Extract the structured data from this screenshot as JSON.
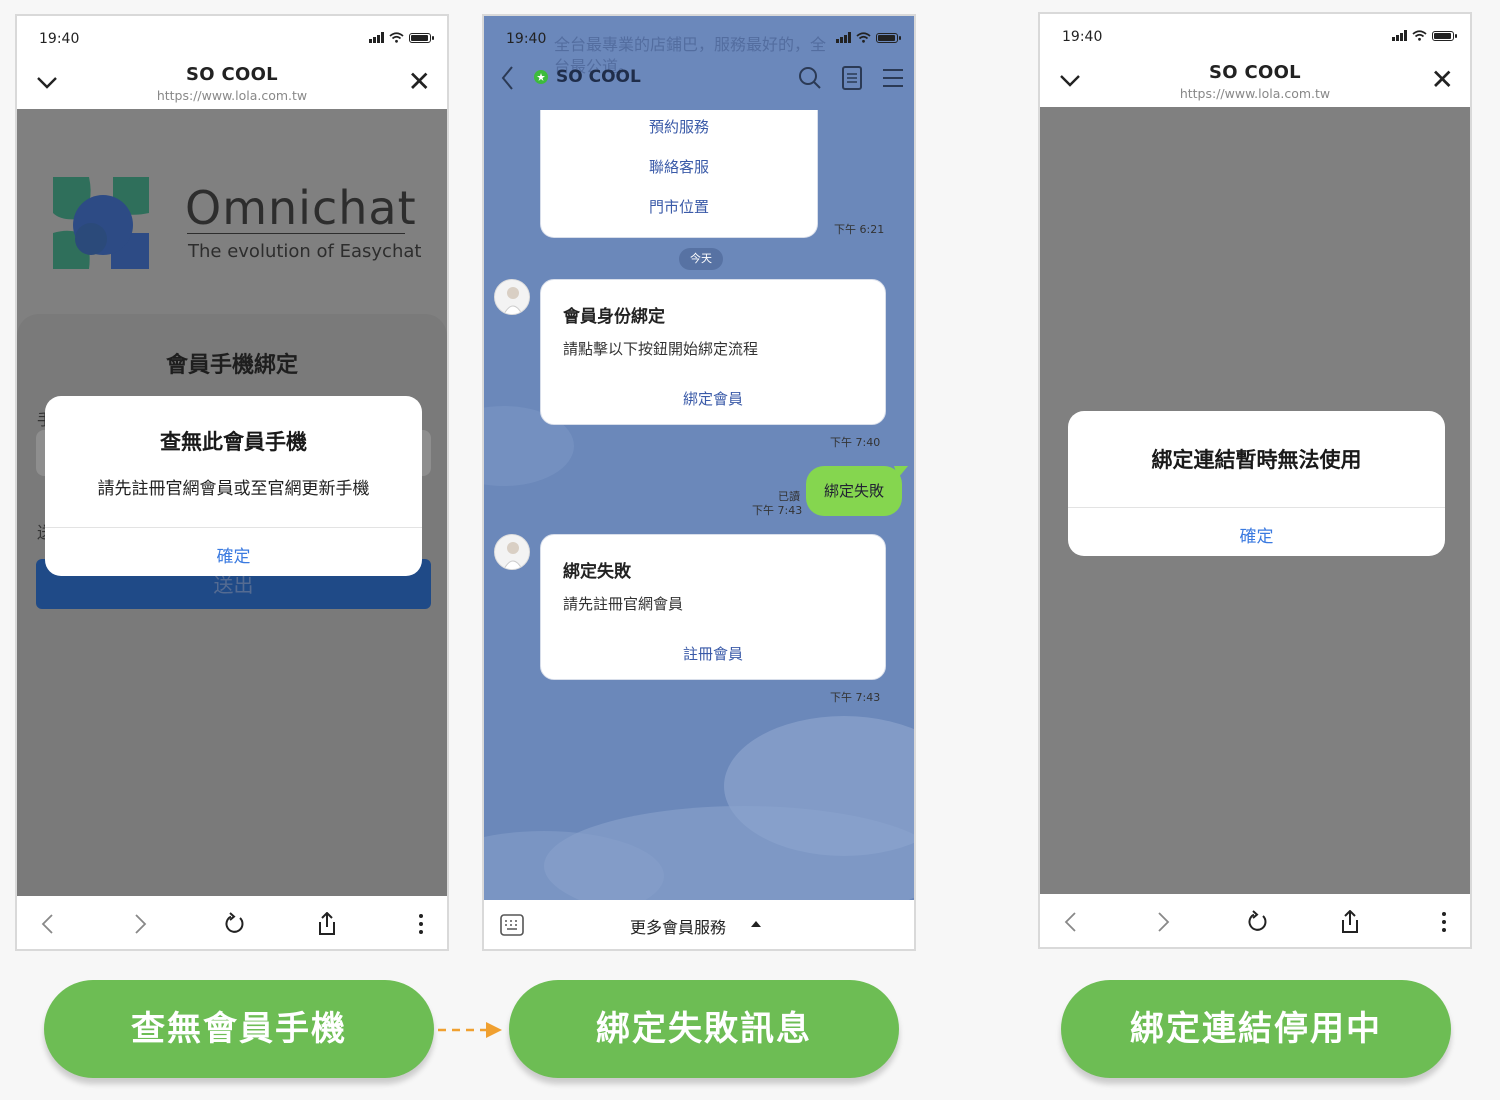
{
  "status_time": "19:40",
  "web_screens": {
    "title": "SO COOL",
    "url": "https://www.lola.com.tw"
  },
  "screen1": {
    "brand_name": "Omnichat",
    "brand_tagline": "The evolution of Easychat",
    "card_title": "會員手機綁定",
    "partial_label_a": "手",
    "partial_label_b": "送",
    "submit_label": "送出",
    "dialog_title": "查無此會員手機",
    "dialog_message": "請先註冊官網會員或至官網更新手機",
    "dialog_confirm": "確定"
  },
  "screen2": {
    "account_name": "SO COOL",
    "ghost_text": "全台最專業的店鋪巴，服務最好的，全台最公道。",
    "menu_items": [
      "預約服務",
      "聯絡客服",
      "門市位置"
    ],
    "menu_time": "下午 6:21",
    "date_chip": "今天",
    "msg1_title": "會員身份綁定",
    "msg1_body": "請點擊以下按鈕開始綁定流程",
    "msg1_link": "綁定會員",
    "msg1_time": "下午 7:40",
    "user_msg": "綁定失敗",
    "read_label": "已讀",
    "user_msg_time": "下午 7:43",
    "msg2_title": "綁定失敗",
    "msg2_body": "請先註冊官網會員",
    "msg2_link": "註冊會員",
    "msg2_time": "下午 7:43",
    "footer_menu": "更多會員服務"
  },
  "screen3": {
    "dialog_title": "綁定連結暫時無法使用",
    "dialog_confirm": "確定"
  },
  "labels": [
    "查無會員手機",
    "綁定失敗訊息",
    "綁定連結停用中"
  ],
  "colors": {
    "pill_green": "#6dbd54",
    "arrow_orange": "#f0a030",
    "link_blue": "#3a7ae0",
    "line_chat_bg": "#6b88ba",
    "submit_blue": "#1f4a87"
  },
  "icons": [
    "chevron-down-icon",
    "close-icon",
    "back-icon",
    "forward-icon",
    "reload-icon",
    "share-icon",
    "more-icon",
    "search-icon",
    "notes-icon",
    "menu-icon",
    "keyboard-icon",
    "caret-up-icon"
  ]
}
